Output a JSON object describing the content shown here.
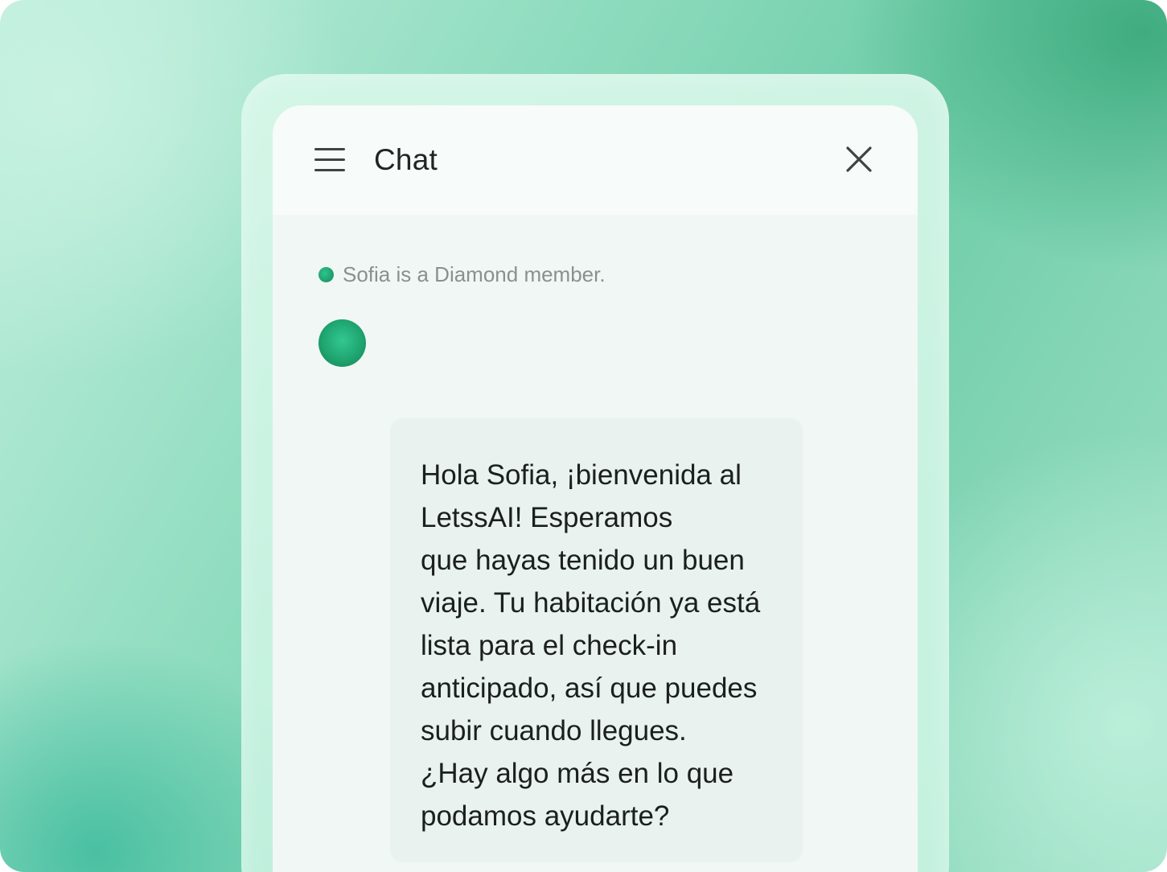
{
  "header": {
    "title": "Chat",
    "menu_icon": "hamburger-menu-icon",
    "close_icon": "close-icon"
  },
  "status": {
    "text": "Sofia is a Diamond member.",
    "indicator_color": "#1f9e6c"
  },
  "message": {
    "avatar_color": "#22a874",
    "text": "Hola Sofia, ¡bienvenida al\nLetssAI! Esperamos\nque hayas tenido un buen\nviaje. Tu habitación ya está\nlista para el check-in\nanticipado, así que puedes\nsubir cuando llegues.\n¿Hay algo más en lo que\npodamos ayudarte?"
  },
  "theme": {
    "accent": "#22a874",
    "background_gradient_start": "#bfeedd",
    "background_gradient_end": "#4fb58c"
  }
}
